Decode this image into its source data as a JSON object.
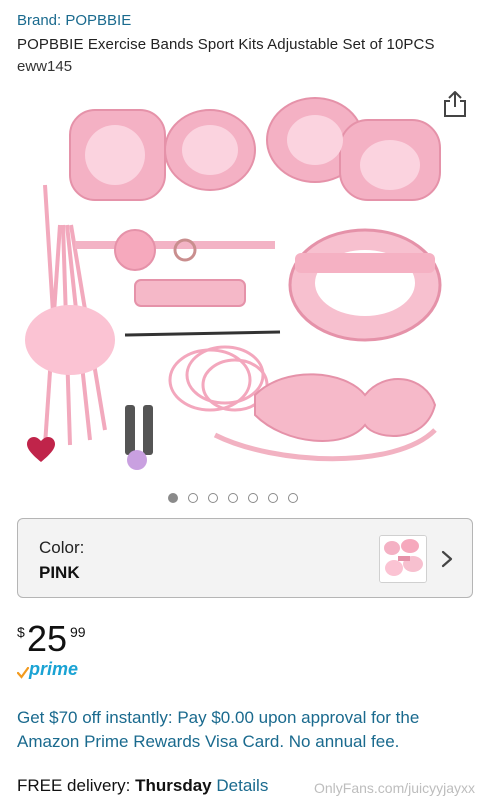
{
  "header": {
    "brand": "Brand: POPBBIE",
    "title": "POPBBIE Exercise Bands Sport Kits Adjustable Set of 10PCS",
    "sku": "eww145"
  },
  "icons": {
    "share": "share-icon",
    "favorite": "heart-icon",
    "chevron": "chevron-right-icon"
  },
  "gallery": {
    "dot_count": 7,
    "active_index": 0
  },
  "color_selector": {
    "label": "Color:",
    "value": "PINK"
  },
  "price": {
    "currency": "$",
    "dollars": "25",
    "cents": "99"
  },
  "prime": {
    "label": "prime"
  },
  "offer": {
    "text": "Get $70 off instantly: Pay $0.00 upon approval for the Amazon Prime Rewards Visa Card. No annual fee."
  },
  "delivery": {
    "prefix": "FREE delivery: ",
    "day": "Thursday",
    "details_link": "Details"
  },
  "watermark": {
    "text": "OnlyFans.com/juicyyjayxx"
  },
  "colors": {
    "link": "#1a6a8e",
    "prime": "#1aa3d4",
    "heart": "#c0244a",
    "product_pink": "#f4b6c6"
  }
}
